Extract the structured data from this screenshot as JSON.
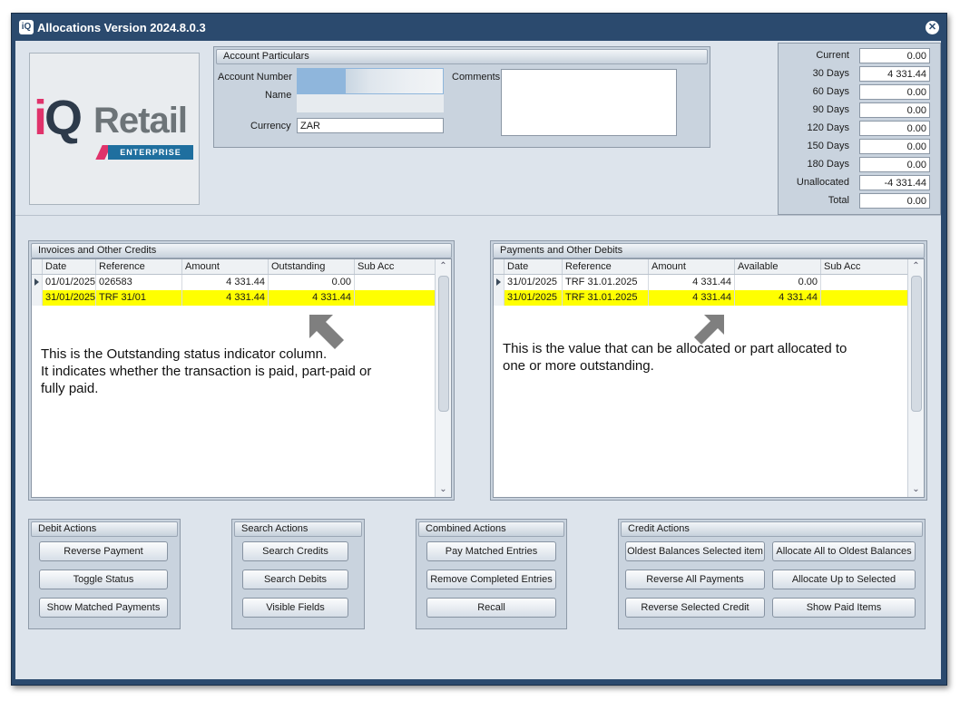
{
  "window": {
    "title": "Allocations Version 2024.8.0.3",
    "icon": "iq-app-icon",
    "close_icon": "close-icon"
  },
  "logo": {
    "iq": "iQ",
    "retail": "Retail",
    "enterprise": "ENTERPRISE"
  },
  "account": {
    "header": "Account Particulars",
    "account_number_label": "Account Number",
    "name_label": "Name",
    "currency_label": "Currency",
    "currency_value": "ZAR",
    "comments_label": "Comments",
    "comments_value": ""
  },
  "ageing": [
    {
      "label": "Current",
      "value": "0.00"
    },
    {
      "label": "30 Days",
      "value": "4 331.44"
    },
    {
      "label": "60 Days",
      "value": "0.00"
    },
    {
      "label": "90 Days",
      "value": "0.00"
    },
    {
      "label": "120 Days",
      "value": "0.00"
    },
    {
      "label": "150 Days",
      "value": "0.00"
    },
    {
      "label": "180 Days",
      "value": "0.00"
    },
    {
      "label": "Unallocated",
      "value": "-4 331.44"
    },
    {
      "label": "Total",
      "value": "0.00"
    }
  ],
  "invoices": {
    "header": "Invoices and Other Credits",
    "columns": [
      "Date",
      "Reference",
      "Amount",
      "Outstanding",
      "Sub Acc"
    ],
    "rows": [
      {
        "date": "01/01/2025",
        "reference": "026583",
        "amount": "4 331.44",
        "outstanding": "0.00",
        "sub_acc": ""
      },
      {
        "date": "31/01/2025",
        "reference": "TRF 31/01",
        "amount": "4 331.44",
        "outstanding": "4 331.44",
        "sub_acc": ""
      }
    ],
    "note": "This is the Outstanding status indicator column.\nIt indicates whether the transaction is paid, part-paid or\nfully paid."
  },
  "payments": {
    "header": "Payments and Other Debits",
    "columns": [
      "Date",
      "Reference",
      "Amount",
      "Available",
      "Sub Acc"
    ],
    "rows": [
      {
        "date": "31/01/2025",
        "reference": "TRF 31.01.2025",
        "amount": "4 331.44",
        "available": "0.00",
        "sub_acc": ""
      },
      {
        "date": "31/01/2025",
        "reference": "TRF 31.01.2025",
        "amount": "4 331.44",
        "available": "4 331.44",
        "sub_acc": ""
      }
    ],
    "note": "This is the value that can be allocated or part allocated to\none or more outstanding."
  },
  "debit_actions": {
    "header": "Debit Actions",
    "buttons": [
      "Reverse Payment",
      "Toggle Status",
      "Show Matched Payments"
    ]
  },
  "search_actions": {
    "header": "Search Actions",
    "buttons": [
      "Search Credits",
      "Search Debits",
      "Visible Fields"
    ]
  },
  "combined_actions": {
    "header": "Combined Actions",
    "buttons": [
      "Pay Matched Entries",
      "Remove Completed Entries",
      "Recall"
    ]
  },
  "credit_actions": {
    "header": "Credit Actions",
    "buttons": [
      "Oldest Balances Selected item",
      "Allocate All to Oldest Balances",
      "Reverse All Payments",
      "Allocate Up to Selected",
      "Reverse Selected Credit",
      "Show Paid Items"
    ]
  },
  "colors": {
    "window_frame": "#2b4a6e",
    "client_bg": "#dde4ec",
    "selected_row": "#ffff00",
    "brand_pink": "#e0336b",
    "brand_blue": "#1f6f9f"
  }
}
